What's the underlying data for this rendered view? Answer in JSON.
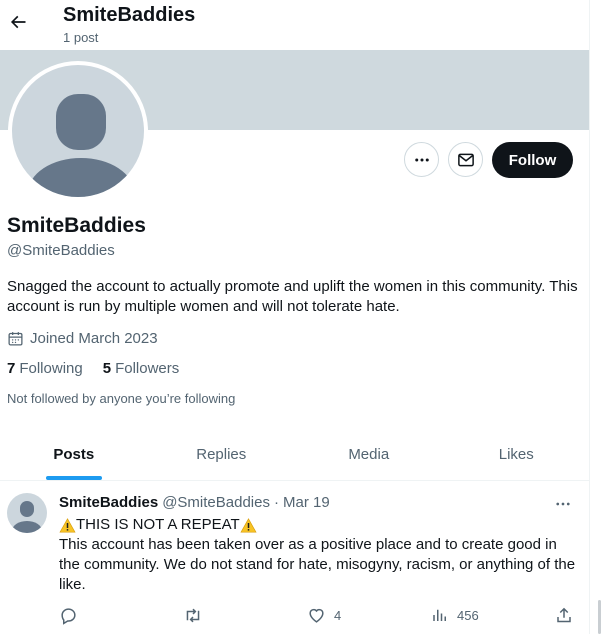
{
  "header": {
    "title": "SmiteBaddies",
    "post_count": "1 post"
  },
  "profile": {
    "name": "SmiteBaddies",
    "handle": "@SmiteBaddies",
    "bio": "Snagged the account to actually promote and uplift the women in this community. This account is run by multiple women and will not tolerate hate.",
    "joined": "Joined March 2023",
    "following_count": "7",
    "following_label": "Following",
    "followers_count": "5",
    "followers_label": "Followers",
    "not_followed": "Not followed by anyone you’re following",
    "follow_label": "Follow"
  },
  "tabs": [
    {
      "label": "Posts",
      "active": true
    },
    {
      "label": "Replies",
      "active": false
    },
    {
      "label": "Media",
      "active": false
    },
    {
      "label": "Likes",
      "active": false
    }
  ],
  "tweet": {
    "name": "SmiteBaddies",
    "handle": "@SmiteBaddies",
    "separator": "·",
    "date": "Mar 19",
    "headline": "THIS IS NOT A REPEAT",
    "body": "This account has been taken over as a positive place and to create good in the community. We do not stand for hate, misogyny, racism, or anything of the like.",
    "likes": "4",
    "views": "456"
  },
  "icons": {
    "back": "arrow-left-icon",
    "more": "more-dots-icon",
    "message": "envelope-icon",
    "calendar": "calendar-icon",
    "warning": "warning-icon",
    "reply": "reply-icon",
    "repost": "repost-icon",
    "like": "heart-icon",
    "views": "bar-chart-icon",
    "share": "share-icon"
  },
  "colors": {
    "accent": "#1d9bf0",
    "banner": "#cfd9de",
    "follow_button": "#0f1419",
    "secondary_text": "#536471"
  }
}
